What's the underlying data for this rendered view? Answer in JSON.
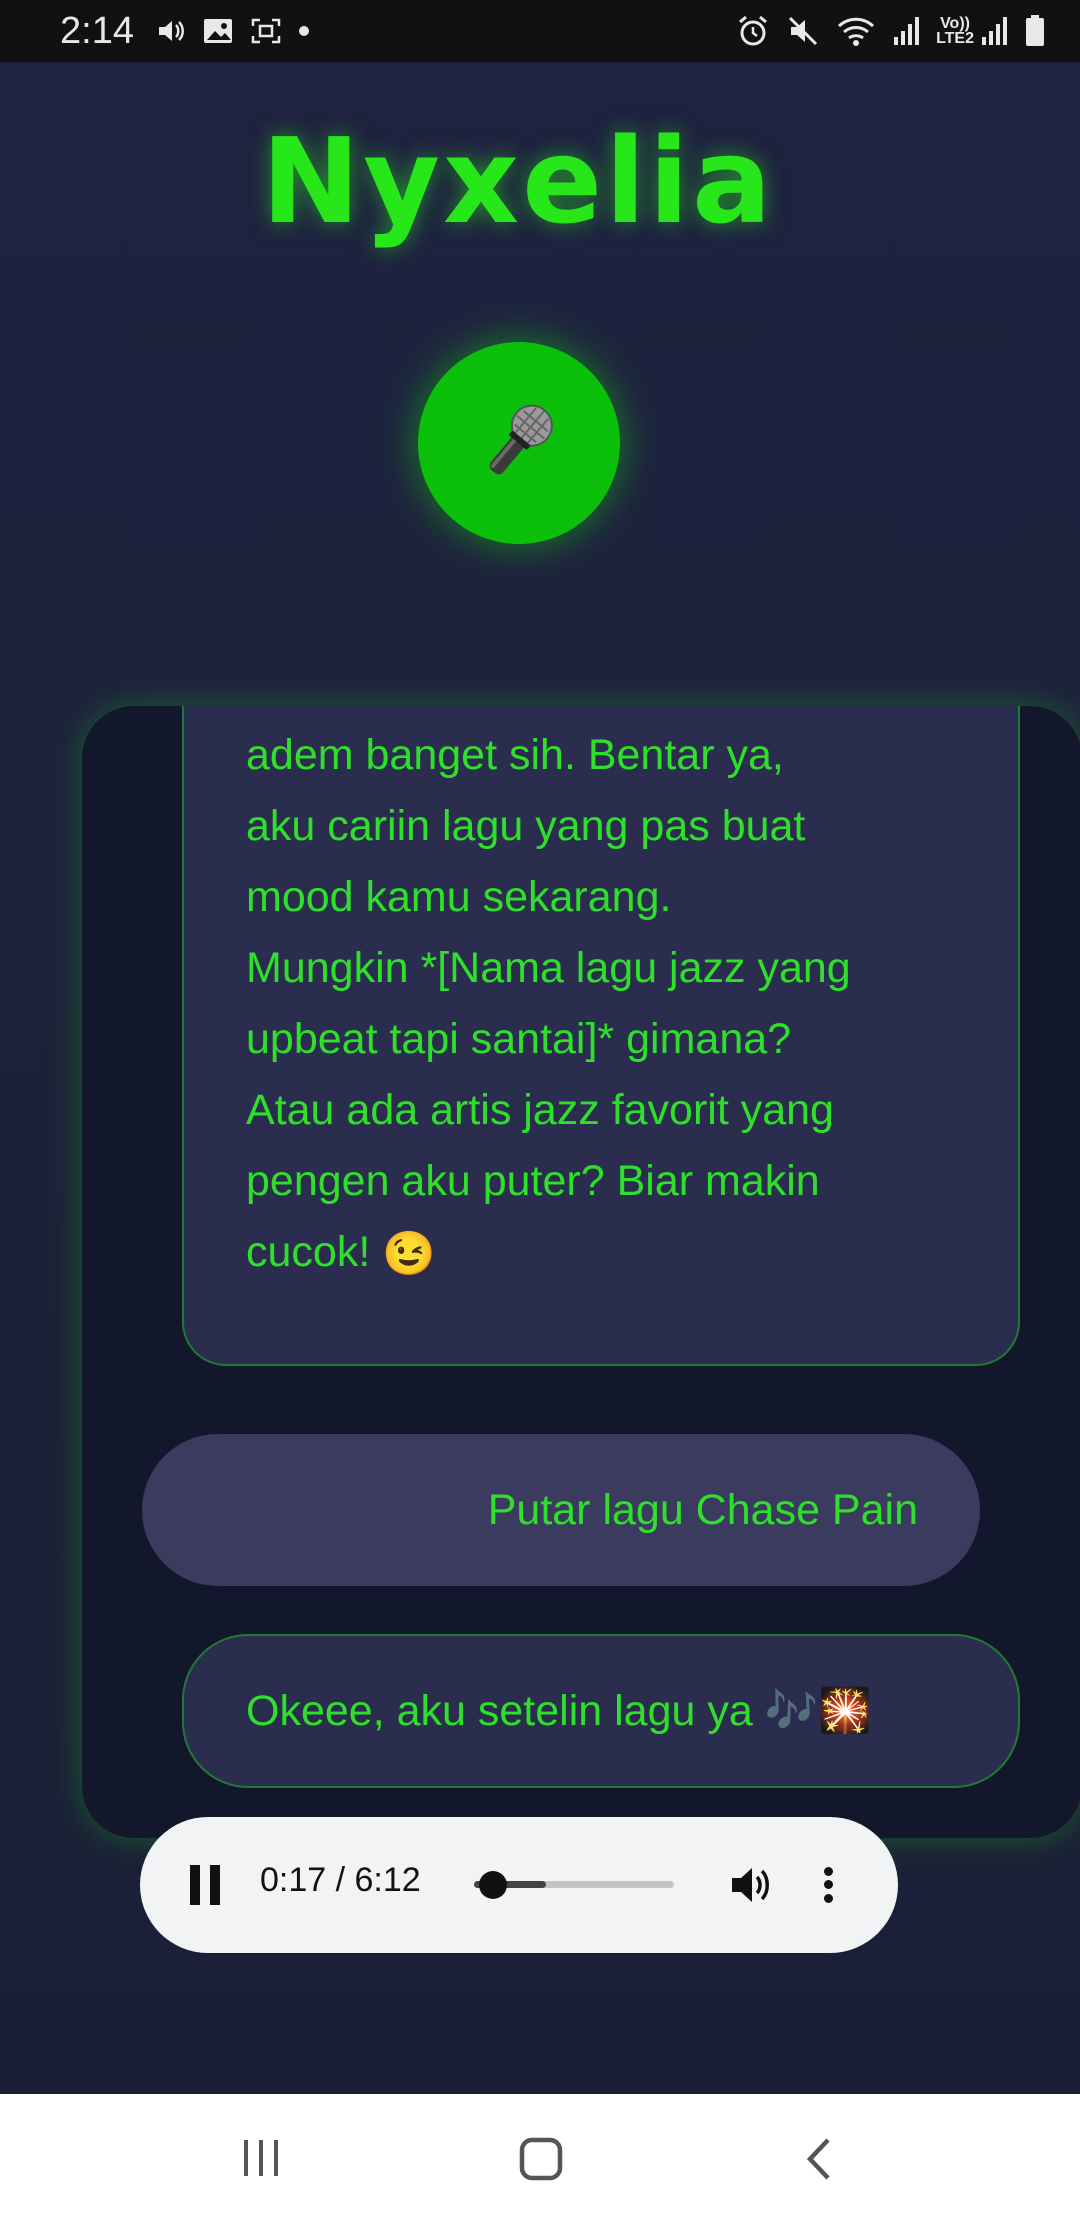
{
  "status_bar": {
    "time": "2:14",
    "left_icons": [
      "volume-icon",
      "image-icon",
      "screenshot-icon",
      "dot-icon"
    ],
    "right_icons": [
      "alarm-icon",
      "mute-icon",
      "wifi-icon",
      "signal-icon",
      "lte-icon",
      "signal-icon",
      "battery-icon"
    ],
    "lte_top": "Vo))",
    "lte_bottom": "LTE2"
  },
  "app": {
    "title": "Nyxelia",
    "mic_icon": "🎤",
    "accent_color": "#27e61a"
  },
  "chat": {
    "messages": [
      {
        "role": "bot",
        "lines": [
          "adem banget sih.  Bentar ya,",
          "aku cariin lagu yang pas buat",
          "mood kamu sekarang.",
          "Mungkin *[Nama lagu jazz yang",
          "upbeat tapi santai]*  gimana?",
          "Atau ada artis jazz favorit yang",
          "pengen aku puter?  Biar makin",
          "cucok!"
        ],
        "emoji": "😉"
      },
      {
        "role": "user",
        "text": "Putar lagu Chase Pain"
      },
      {
        "role": "bot",
        "text": "Okeee, aku setelin lagu ya",
        "emoji": "🎶🎇"
      }
    ]
  },
  "audio_player": {
    "time": "0:17 / 6:12",
    "progress": 0.046,
    "buffered": 0.36
  },
  "nav_bar": {
    "buttons": [
      "recent-apps-icon",
      "home-icon",
      "back-icon"
    ]
  }
}
